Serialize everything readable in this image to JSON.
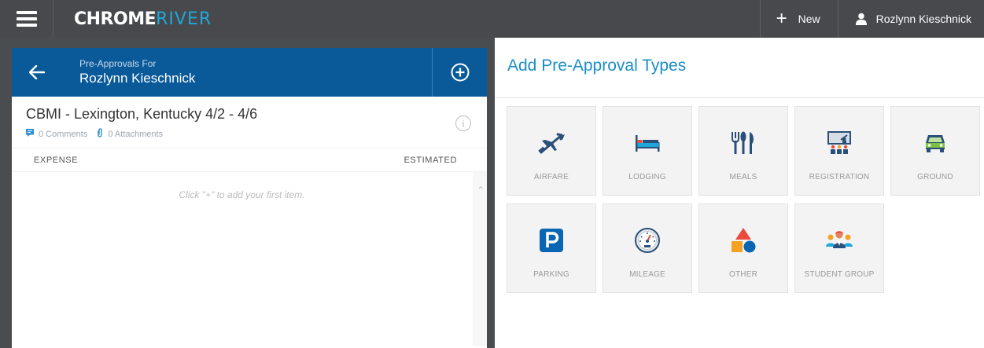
{
  "topbar": {
    "logo_part1": "CHROME",
    "logo_part2": "RIVER",
    "new_label": "New",
    "user_name": "Rozlynn Kieschnick"
  },
  "left": {
    "header_sub": "Pre-Approvals For",
    "header_name": "Rozlynn Kieschnick",
    "report_title": "CBMI - Lexington, Kentucky 4/2 - 4/6",
    "comments": "0 Comments",
    "attachments": "0 Attachments",
    "col_expense": "EXPENSE",
    "col_estimated": "ESTIMATED",
    "empty_message": "Click \"+\" to add your first item.",
    "accent_color": "#0a5a9a"
  },
  "right": {
    "title": "Add Pre-Approval Types",
    "tiles": [
      {
        "label": "AIRFARE",
        "icon": "airplane-icon"
      },
      {
        "label": "LODGING",
        "icon": "bed-icon"
      },
      {
        "label": "MEALS",
        "icon": "utensils-icon"
      },
      {
        "label": "REGISTRATION",
        "icon": "registration-icon"
      },
      {
        "label": "GROUND",
        "icon": "car-icon"
      },
      {
        "label": "PARKING",
        "icon": "parking-icon"
      },
      {
        "label": "MILEAGE",
        "icon": "speedometer-icon"
      },
      {
        "label": "OTHER",
        "icon": "shapes-icon"
      },
      {
        "label": "STUDENT GROUP",
        "icon": "group-icon"
      }
    ]
  }
}
